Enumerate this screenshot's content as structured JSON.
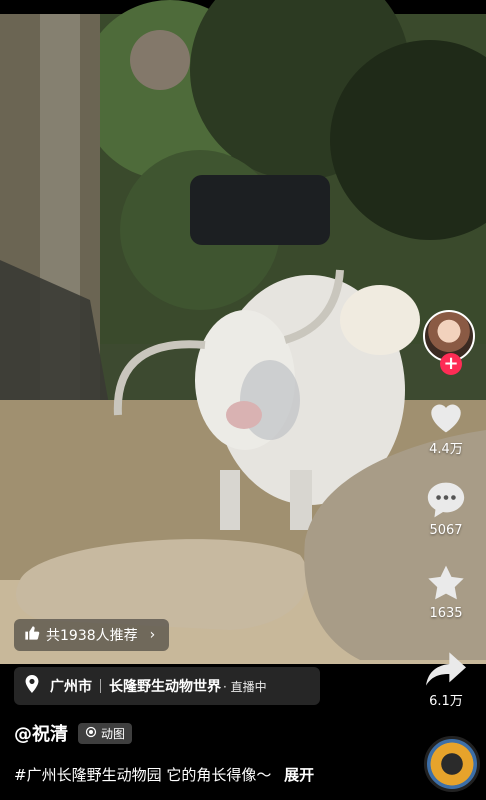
{
  "recommend": {
    "label": "共1938人推荐"
  },
  "location": {
    "city": "广州市",
    "place": "长隆野生动物世界",
    "status": "· 直播中"
  },
  "author": {
    "username": "@祝清",
    "badge": "动图"
  },
  "caption": {
    "text": "#广州长隆野生动物园 它的角长得像～",
    "more": "展开"
  },
  "actions": {
    "likes": "4.4万",
    "comments": "5067",
    "favorites": "1635",
    "shares": "6.1万"
  },
  "colors": {
    "follow": "#fe2c55",
    "text": "#ffffff"
  },
  "icons": [
    "thumbs-up-icon",
    "location-pin-icon",
    "gif-icon",
    "heart-icon",
    "comment-icon",
    "star-icon",
    "share-icon",
    "plus-icon"
  ]
}
